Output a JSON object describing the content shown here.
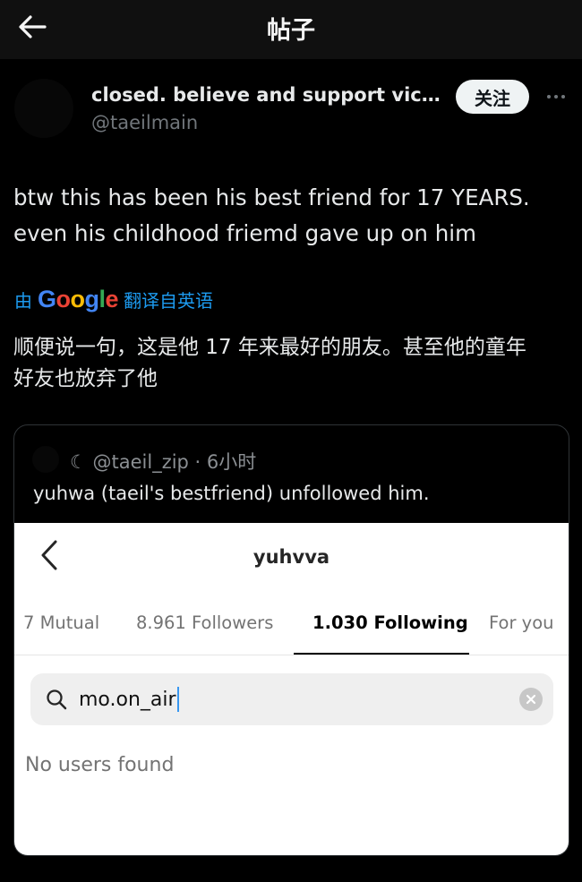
{
  "topbar": {
    "title": "帖子",
    "back_icon": "arrow-left-icon"
  },
  "post": {
    "author_name": "closed. believe and support vict...",
    "author_handle": "@taeilmain",
    "follow_label": "关注",
    "more_icon": "more-horizontal-icon",
    "text_lines": [
      "btw this has been his best friend for 17 YEARS.",
      "even his childhood friemd gave up on him"
    ],
    "translate": {
      "prefix": "由",
      "provider": "Google",
      "suffix": "翻译自英语"
    },
    "translated_lines": [
      "顺便说一句，这是他 17 年来最好的朋友。甚至他的童年",
      "好友也放弃了他"
    ]
  },
  "quote": {
    "meta": "☾ @taeil_zip · 6小时",
    "text": "yuhwa (taeil's bestfriend) unfollowed him."
  },
  "instagram": {
    "username": "yuhvva",
    "back_icon": "chevron-left-icon",
    "tabs": [
      {
        "label": "7 Mutual",
        "active": false
      },
      {
        "label": "8.961 Followers",
        "active": false
      },
      {
        "label": "1.030 Following",
        "active": true
      },
      {
        "label": "For you",
        "active": false
      }
    ],
    "search_value": "mo.on_air",
    "search_icon": "search-icon",
    "clear_icon": "clear-icon",
    "empty_message": "No users found"
  },
  "colors": {
    "background": "#000000",
    "topbar": "#101010",
    "accent_link": "#1d9bf0",
    "muted_text": "#71767b",
    "follow_button": "#eff3f4"
  }
}
